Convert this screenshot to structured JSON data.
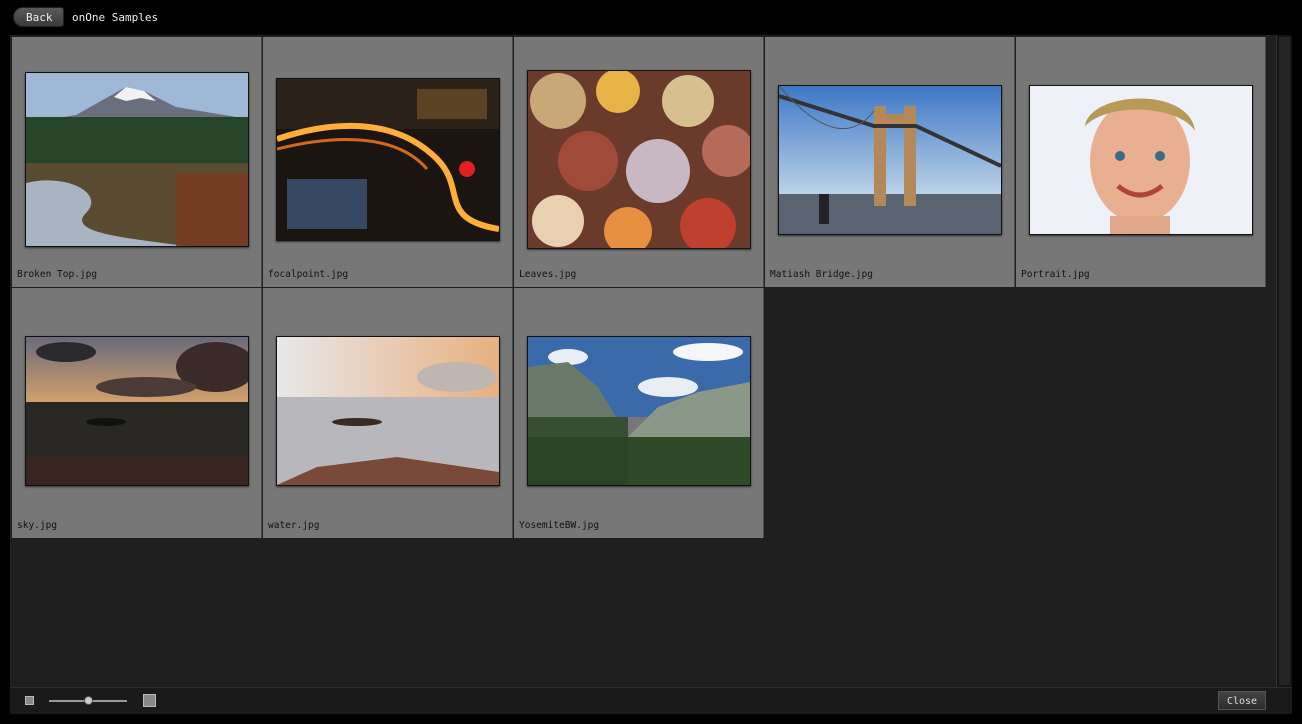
{
  "header": {
    "back_label": "Back",
    "title": "onOne Samples"
  },
  "files": [
    {
      "name": "Broken Top.jpg",
      "thumb": "mountain-river"
    },
    {
      "name": "focalpoint.jpg",
      "thumb": "city-night"
    },
    {
      "name": "Leaves.jpg",
      "thumb": "autumn-leaves"
    },
    {
      "name": "Matiash Bridge.jpg",
      "thumb": "bridge"
    },
    {
      "name": "Portrait.jpg",
      "thumb": "portrait"
    },
    {
      "name": "sky.jpg",
      "thumb": "sunset-sea"
    },
    {
      "name": "water.jpg",
      "thumb": "misty-water"
    },
    {
      "name": "YosemiteBW.jpg",
      "thumb": "valley"
    }
  ],
  "footer": {
    "zoom_value": 50,
    "close_label": "Close"
  }
}
